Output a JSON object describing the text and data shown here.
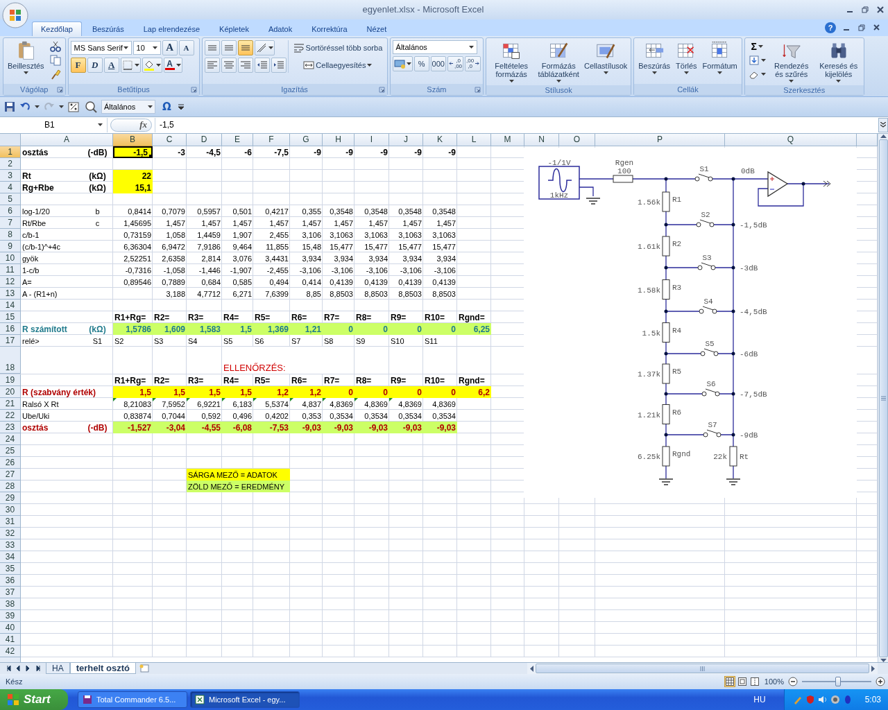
{
  "window": {
    "title": "egyenlet.xlsx - Microsoft Excel",
    "help": "?"
  },
  "ribbon": {
    "tabs": [
      {
        "label": "Kezdőlap",
        "selected": true
      },
      {
        "label": "Beszúrás",
        "selected": false
      },
      {
        "label": "Lap elrendezése",
        "selected": false
      },
      {
        "label": "Képletek",
        "selected": false
      },
      {
        "label": "Adatok",
        "selected": false
      },
      {
        "label": "Korrektúra",
        "selected": false
      },
      {
        "label": "Nézet",
        "selected": false
      }
    ],
    "groups": [
      {
        "kind": "clipboard",
        "label": "Vágólap",
        "launcher": true,
        "buttons": [
          {
            "label": "Beillesztés"
          }
        ]
      },
      {
        "kind": "font",
        "label": "Betűtípus",
        "launcher": true,
        "font": "MS Sans Serif",
        "size": "10",
        "grow": "A",
        "shrink": "A",
        "styles": [
          {
            "label": "F",
            "on": true
          },
          {
            "label": "D",
            "on": false
          },
          {
            "label": "A",
            "on": false
          }
        ],
        "font_color": "A"
      },
      {
        "kind": "alignment",
        "label": "Igazítás",
        "launcher": true,
        "vertical": [
          {
            "on": false
          },
          {
            "on": false
          },
          {
            "on": true
          }
        ],
        "wrap": "Sortöréssel több sorba",
        "merge": "Cellaegyesítés"
      },
      {
        "kind": "number",
        "label": "Szám",
        "launcher": true,
        "format": "Általános",
        "percent": "%",
        "thousands": "000",
        "increase_decimals": [
          ",0",
          ",00"
        ],
        "decrease_decimals": [
          ",00",
          ",0"
        ]
      },
      {
        "kind": "large",
        "label": "Stílusok",
        "buttons": [
          {
            "label": "Feltételes formázás"
          },
          {
            "label": "Formázás táblázatként"
          },
          {
            "label": "Cellastílusok"
          }
        ]
      },
      {
        "kind": "large",
        "label": "Cellák",
        "buttons": [
          {
            "label": "Beszúrás"
          },
          {
            "label": "Törlés"
          },
          {
            "label": "Formátum"
          }
        ]
      },
      {
        "kind": "editing",
        "label": "Szerkesztés",
        "sum": "Σ",
        "buttons": [
          {
            "label": "Rendezés és szűrés"
          },
          {
            "label": "Keresés és kijelölés"
          }
        ]
      }
    ]
  },
  "quick_access": {
    "format": "Általános",
    "symbol": "Ω"
  },
  "formula_bar": {
    "name_box": "B1",
    "function": "fx",
    "value": "-1,5"
  },
  "sheet": {
    "columns": [
      {
        "label": "A",
        "selected": false
      },
      {
        "label": "B",
        "selected": true
      },
      {
        "label": "C",
        "selected": false
      },
      {
        "label": "D",
        "selected": false
      },
      {
        "label": "E",
        "selected": false
      },
      {
        "label": "F",
        "selected": false
      },
      {
        "label": "G",
        "selected": false
      },
      {
        "label": "H",
        "selected": false
      },
      {
        "label": "I",
        "selected": false
      },
      {
        "label": "J",
        "selected": false
      },
      {
        "label": "K",
        "selected": false
      },
      {
        "label": "L",
        "selected": false
      },
      {
        "label": "M",
        "selected": false
      },
      {
        "label": "N",
        "selected": false
      },
      {
        "label": "O",
        "selected": false
      },
      {
        "label": "P",
        "selected": false
      },
      {
        "label": "Q",
        "selected": false
      }
    ],
    "rows": [
      {
        "number": "1",
        "selected": true,
        "kind": "label",
        "cells": [
          {
            "text": "osztás",
            "unit": "(-dB)"
          },
          {
            "text": "-1,5",
            "color": "#ffff00"
          },
          {
            "text": "-3"
          },
          {
            "text": "-4,5"
          },
          {
            "text": "-6"
          },
          {
            "text": "-7,5"
          },
          {
            "text": "-9"
          },
          {
            "text": "-9"
          },
          {
            "text": "-9"
          },
          {
            "text": "-9"
          },
          {
            "text": "-9"
          }
        ]
      },
      {
        "number": "2",
        "selected": false,
        "kind": "blank",
        "cells": []
      },
      {
        "number": "3",
        "selected": false,
        "kind": "label",
        "cells": [
          {
            "text": "Rt",
            "unit": "(kΩ)"
          },
          {
            "text": "22",
            "color": "#ffff00"
          }
        ]
      },
      {
        "number": "4",
        "selected": false,
        "kind": "label",
        "cells": [
          {
            "text": "Rg+Rbe",
            "unit": "(kΩ)"
          },
          {
            "text": "15,1",
            "color": "#ffff00"
          }
        ]
      },
      {
        "number": "5",
        "selected": false,
        "kind": "blank",
        "cells": []
      },
      {
        "number": "6",
        "selected": false,
        "kind": "data",
        "cells": [
          {
            "text": "log-1/20",
            "unit": "b"
          },
          {
            "text": "0,8414"
          },
          {
            "text": "0,7079"
          },
          {
            "text": "0,5957"
          },
          {
            "text": "0,501"
          },
          {
            "text": "0,4217"
          },
          {
            "text": "0,355"
          },
          {
            "text": "0,3548"
          },
          {
            "text": "0,3548"
          },
          {
            "text": "0,3548"
          },
          {
            "text": "0,3548"
          }
        ]
      },
      {
        "number": "7",
        "selected": false,
        "kind": "data",
        "cells": [
          {
            "text": "Rt/Rbe",
            "unit": "c"
          },
          {
            "text": "1,45695"
          },
          {
            "text": "1,457"
          },
          {
            "text": "1,457"
          },
          {
            "text": "1,457"
          },
          {
            "text": "1,457"
          },
          {
            "text": "1,457"
          },
          {
            "text": "1,457"
          },
          {
            "text": "1,457"
          },
          {
            "text": "1,457"
          },
          {
            "text": "1,457"
          }
        ]
      },
      {
        "number": "8",
        "selected": false,
        "kind": "data",
        "cells": [
          {
            "text": "c/b-1"
          },
          {
            "text": "0,73159"
          },
          {
            "text": "1,058"
          },
          {
            "text": "1,4459"
          },
          {
            "text": "1,907"
          },
          {
            "text": "2,455"
          },
          {
            "text": "3,106"
          },
          {
            "text": "3,1063"
          },
          {
            "text": "3,1063"
          },
          {
            "text": "3,1063"
          },
          {
            "text": "3,1063"
          }
        ]
      },
      {
        "number": "9",
        "selected": false,
        "kind": "data",
        "cells": [
          {
            "text": "(c/b-1)^+4c"
          },
          {
            "text": "6,36304"
          },
          {
            "text": "6,9472"
          },
          {
            "text": "7,9186"
          },
          {
            "text": "9,464"
          },
          {
            "text": "11,855"
          },
          {
            "text": "15,48"
          },
          {
            "text": "15,477"
          },
          {
            "text": "15,477"
          },
          {
            "text": "15,477"
          },
          {
            "text": "15,477"
          }
        ]
      },
      {
        "number": "10",
        "selected": false,
        "kind": "data",
        "cells": [
          {
            "text": "gyök"
          },
          {
            "text": "2,52251"
          },
          {
            "text": "2,6358"
          },
          {
            "text": "2,814"
          },
          {
            "text": "3,076"
          },
          {
            "text": "3,4431"
          },
          {
            "text": "3,934"
          },
          {
            "text": "3,934"
          },
          {
            "text": "3,934"
          },
          {
            "text": "3,934"
          },
          {
            "text": "3,934"
          }
        ]
      },
      {
        "number": "11",
        "selected": false,
        "kind": "data",
        "cells": [
          {
            "text": "1-c/b"
          },
          {
            "text": "-0,7316"
          },
          {
            "text": "-1,058"
          },
          {
            "text": "-1,446"
          },
          {
            "text": "-1,907"
          },
          {
            "text": "-2,455"
          },
          {
            "text": "-3,106"
          },
          {
            "text": "-3,106"
          },
          {
            "text": "-3,106"
          },
          {
            "text": "-3,106"
          },
          {
            "text": "-3,106"
          }
        ]
      },
      {
        "number": "12",
        "selected": false,
        "kind": "data",
        "cells": [
          {
            "text": "A="
          },
          {
            "text": "0,89546"
          },
          {
            "text": "0,7889"
          },
          {
            "text": "0,684"
          },
          {
            "text": "0,585"
          },
          {
            "text": "0,494"
          },
          {
            "text": "0,414"
          },
          {
            "text": "0,4139"
          },
          {
            "text": "0,4139"
          },
          {
            "text": "0,4139"
          },
          {
            "text": "0,4139"
          }
        ]
      },
      {
        "number": "13",
        "selected": false,
        "kind": "data",
        "cells": [
          {
            "text": "A - (R1+n)"
          },
          {},
          {
            "text": "3,188"
          },
          {
            "text": "4,7712"
          },
          {
            "text": "6,271"
          },
          {
            "text": "7,6399"
          },
          {
            "text": "8,85"
          },
          {
            "text": "8,8503"
          },
          {
            "text": "8,8503"
          },
          {
            "text": "8,8503"
          },
          {
            "text": "8,8503"
          }
        ]
      },
      {
        "number": "14",
        "selected": false,
        "kind": "blank",
        "cells": []
      },
      {
        "number": "15",
        "selected": false,
        "kind": "headers",
        "cells": [
          {},
          {
            "text": "R1+Rg="
          },
          {
            "text": "R2="
          },
          {
            "text": "R3="
          },
          {
            "text": "R4="
          },
          {
            "text": "R5="
          },
          {
            "text": "R6="
          },
          {
            "text": "R7="
          },
          {
            "text": "R8="
          },
          {
            "text": "R9="
          },
          {
            "text": "R10="
          },
          {
            "text": "Rgnd="
          }
        ]
      },
      {
        "number": "16",
        "selected": false,
        "kind": "computed",
        "cells": [
          {
            "text": "R számított",
            "unit": "(kΩ)"
          },
          {
            "text": "1,5786",
            "color": "#ccff66"
          },
          {
            "text": "1,609",
            "color": "#ccff66"
          },
          {
            "text": "1,583",
            "color": "#ccff66"
          },
          {
            "text": "1,5",
            "color": "#ccff66"
          },
          {
            "text": "1,369",
            "color": "#ccff66"
          },
          {
            "text": "1,21",
            "color": "#ccff66"
          },
          {
            "text": "0",
            "color": "#ccff66"
          },
          {
            "text": "0",
            "color": "#ccff66"
          },
          {
            "text": "0",
            "color": "#ccff66"
          },
          {
            "text": "0",
            "color": "#ccff66"
          },
          {
            "text": "6,25",
            "color": "#ccff66"
          }
        ]
      },
      {
        "number": "17",
        "selected": false,
        "kind": "relay",
        "cells": [
          {
            "text": "relé>",
            "unit": "S1"
          },
          {
            "text": "S2"
          },
          {
            "text": "S3"
          },
          {
            "text": "S4"
          },
          {
            "text": "S5"
          },
          {
            "text": "S6"
          },
          {
            "text": "S7"
          },
          {
            "text": "S8"
          },
          {
            "text": "S9"
          },
          {
            "text": "S10"
          },
          {
            "text": "S11"
          }
        ]
      },
      {
        "number": "18",
        "selected": false,
        "kind": "heading",
        "cells": [
          {},
          {},
          {},
          {},
          {
            "text": "ELLENŐRZÉS:"
          },
          {},
          {}
        ]
      },
      {
        "number": "19",
        "selected": false,
        "kind": "headers",
        "cells": [
          {},
          {
            "text": "R1+Rg="
          },
          {
            "text": "R2="
          },
          {
            "text": "R3="
          },
          {
            "text": "R4="
          },
          {
            "text": "R5="
          },
          {
            "text": "R6="
          },
          {
            "text": "R7="
          },
          {
            "text": "R8="
          },
          {
            "text": "R9="
          },
          {
            "text": "R10="
          },
          {
            "text": "Rgnd="
          }
        ]
      },
      {
        "number": "20",
        "selected": false,
        "kind": "check",
        "cells": [
          {
            "text": "R (szabvány érték)"
          },
          {
            "text": "1,5",
            "color": "#ffff00"
          },
          {
            "text": "1,5",
            "color": "#ffff00"
          },
          {
            "text": "1,5",
            "color": "#ffff00"
          },
          {
            "text": "1,5",
            "color": "#ffff00"
          },
          {
            "text": "1,2",
            "color": "#ffff00"
          },
          {
            "text": "1,2",
            "color": "#ffff00"
          },
          {
            "text": "0",
            "color": "#ffff00"
          },
          {
            "text": "0",
            "color": "#ffff00"
          },
          {
            "text": "0",
            "color": "#ffff00"
          },
          {
            "text": "0",
            "color": "#ffff00"
          },
          {
            "text": "6,2",
            "color": "#ffff00"
          }
        ]
      },
      {
        "number": "21",
        "selected": false,
        "kind": "data",
        "cells": [
          {
            "text": "Ralsó X Rt"
          },
          {
            "text": "8,21083",
            "warning": true
          },
          {
            "text": "7,5952",
            "warning": true
          },
          {
            "text": "6,9221",
            "warning": true
          },
          {
            "text": "6,183",
            "warning": true
          },
          {
            "text": "5,5374",
            "warning": true
          },
          {
            "text": "4,837",
            "warning": true
          },
          {
            "text": "4,8369",
            "warning": true
          },
          {
            "text": "4,8369",
            "warning": true
          },
          {
            "text": "4,8369",
            "warning": true
          },
          {
            "text": "4,8369",
            "warning": false
          }
        ]
      },
      {
        "number": "22",
        "selected": false,
        "kind": "data",
        "cells": [
          {
            "text": "Ube/Uki"
          },
          {
            "text": "0,83874"
          },
          {
            "text": "0,7044"
          },
          {
            "text": "0,592"
          },
          {
            "text": "0,496"
          },
          {
            "text": "0,4202"
          },
          {
            "text": "0,353"
          },
          {
            "text": "0,3534"
          },
          {
            "text": "0,3534"
          },
          {
            "text": "0,3534"
          },
          {
            "text": "0,3534"
          }
        ]
      },
      {
        "number": "23",
        "selected": false,
        "kind": "check",
        "cells": [
          {
            "text": "osztás",
            "unit": "(-dB)"
          },
          {
            "text": "-1,527",
            "color": "#ccff66"
          },
          {
            "text": "-3,04",
            "color": "#ccff66"
          },
          {
            "text": "-4,55",
            "color": "#ccff66"
          },
          {
            "text": "-6,08",
            "color": "#ccff66"
          },
          {
            "text": "-7,53",
            "color": "#ccff66"
          },
          {
            "text": "-9,03",
            "color": "#ccff66"
          },
          {
            "text": "-9,03",
            "color": "#ccff66"
          },
          {
            "text": "-9,03",
            "color": "#ccff66"
          },
          {
            "text": "-9,03",
            "color": "#ccff66"
          },
          {
            "text": "-9,03",
            "color": "#ccff66"
          }
        ]
      },
      {
        "number": "24",
        "selected": false,
        "kind": "blank",
        "cells": []
      },
      {
        "number": "25",
        "selected": false,
        "kind": "blank",
        "cells": []
      },
      {
        "number": "26",
        "selected": false,
        "kind": "blank",
        "cells": []
      },
      {
        "number": "27",
        "selected": false,
        "kind": "note",
        "cells": [
          {},
          {},
          {},
          {
            "text": "SÁRGA MEZŐ = ADATOK",
            "color": "#ffff00"
          },
          {
            "color": "#ffff00"
          },
          {
            "color": "#ffff00"
          }
        ]
      },
      {
        "number": "28",
        "selected": false,
        "kind": "note",
        "cells": [
          {},
          {},
          {},
          {
            "text": "ZÖLD MEZŐ = EREDMÉNY",
            "color": "#ccff66"
          },
          {
            "color": "#ccff66"
          },
          {
            "color": "#ccff66"
          }
        ]
      },
      {
        "number": "29",
        "selected": false,
        "kind": "blank",
        "cells": []
      },
      {
        "number": "30",
        "selected": false,
        "kind": "blank",
        "cells": []
      },
      {
        "number": "31",
        "selected": false,
        "kind": "blank",
        "cells": []
      },
      {
        "number": "32",
        "selected": false,
        "kind": "blank",
        "cells": []
      },
      {
        "number": "33",
        "selected": false,
        "kind": "blank",
        "cells": []
      },
      {
        "number": "34",
        "selected": false,
        "kind": "blank",
        "cells": []
      },
      {
        "number": "35",
        "selected": false,
        "kind": "blank",
        "cells": []
      },
      {
        "number": "36",
        "selected": false,
        "kind": "blank",
        "cells": []
      },
      {
        "number": "37",
        "selected": false,
        "kind": "blank",
        "cells": []
      },
      {
        "number": "38",
        "selected": false,
        "kind": "blank",
        "cells": []
      },
      {
        "number": "39",
        "selected": false,
        "kind": "blank",
        "cells": []
      },
      {
        "number": "40",
        "selected": false,
        "kind": "blank",
        "cells": []
      },
      {
        "number": "41",
        "selected": false,
        "kind": "blank",
        "cells": []
      },
      {
        "number": "42",
        "selected": false,
        "kind": "blank",
        "cells": []
      }
    ],
    "schematic": {
      "source": {
        "amplitude": "-1/1V",
        "frequency": "1kHz"
      },
      "series_resistor": {
        "name": "Rgen",
        "value": "100"
      },
      "taps": [
        {
          "switch": "S1",
          "output": "0dB"
        },
        {
          "switch": "S2",
          "output": "-1,5dB"
        },
        {
          "switch": "S3",
          "output": "-3dB"
        },
        {
          "switch": "S4",
          "output": "-4,5dB"
        },
        {
          "switch": "S5",
          "output": "-6dB"
        },
        {
          "switch": "S6",
          "output": "-7,5dB"
        },
        {
          "switch": "S7",
          "output": "-9dB"
        }
      ],
      "ladder": [
        {
          "name": "R1",
          "value": "1.56k"
        },
        {
          "name": "R2",
          "value": "1.61k"
        },
        {
          "name": "R3",
          "value": "1.58k"
        },
        {
          "name": "R4",
          "value": "1.5k"
        },
        {
          "name": "R5",
          "value": "1.37k"
        },
        {
          "name": "R6",
          "value": "1.21k"
        },
        {
          "name": "Rgnd",
          "value": "6.25k"
        }
      ],
      "load": {
        "name": "Rt",
        "value": "22k"
      }
    }
  },
  "sheet_tabs": [
    {
      "label": "HA",
      "selected": false
    },
    {
      "label": "terhelt osztó",
      "selected": true
    }
  ],
  "status": {
    "text": "Kész",
    "zoom": "100%",
    "zoom_slider": {
      "level": 0.52
    }
  },
  "taskbar": {
    "start": "Start",
    "tasks": [
      {
        "label": "Total Commander 6.5...",
        "selected": false
      },
      {
        "label": "Microsoft Excel - egy...",
        "selected": true
      }
    ],
    "language": "HU",
    "clock": "5:03"
  }
}
